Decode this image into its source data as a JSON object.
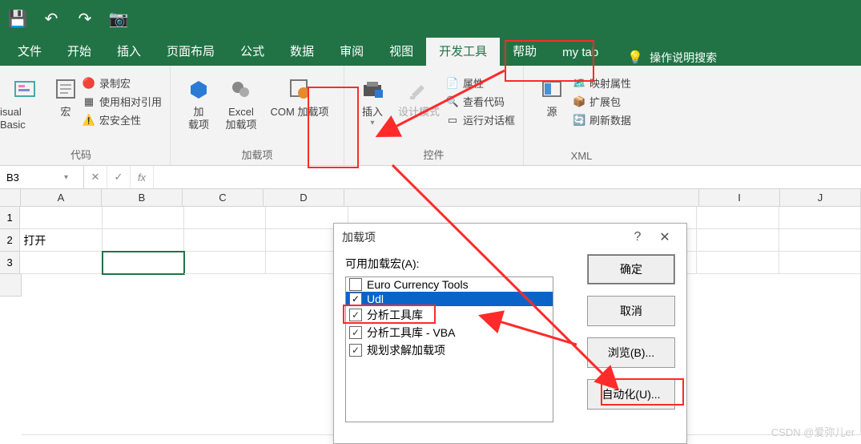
{
  "qat": {
    "save": "💾",
    "undo": "↶",
    "redo": "↷",
    "camera": "📷"
  },
  "tabs": [
    "文件",
    "开始",
    "插入",
    "页面布局",
    "公式",
    "数据",
    "审阅",
    "视图",
    "开发工具",
    "帮助",
    "my tab"
  ],
  "active_tab": "开发工具",
  "tell_me": "操作说明搜索",
  "groups": {
    "code": {
      "label": "代码",
      "vb": "isual Basic",
      "macros": "宏",
      "record": "录制宏",
      "relative": "使用相对引用",
      "security": "宏安全性"
    },
    "addins": {
      "label": "加载项",
      "addins_btn": "加\n载项",
      "excel_addins": "Excel\n加载项",
      "com_addins": "COM 加载项"
    },
    "controls": {
      "label": "控件",
      "insert": "插入",
      "design": "设计模式",
      "properties": "属性",
      "viewcode": "查看代码",
      "dialog": "运行对话框"
    },
    "xml": {
      "label": "XML",
      "source": "源",
      "mapprops": "映射属性",
      "expansion": "扩展包",
      "refresh": "刷新数据"
    }
  },
  "namebox": "B3",
  "cols": [
    "A",
    "B",
    "C",
    "D",
    "",
    "",
    "",
    "",
    "",
    "I",
    "J"
  ],
  "rows": {
    "1": [
      ""
    ],
    "2": [
      "打开"
    ],
    "3": [
      ""
    ]
  },
  "dialog": {
    "title": "加载项",
    "help": "?",
    "available": "可用加载宏(A):",
    "items": [
      {
        "checked": false,
        "label": "Euro Currency Tools",
        "selected": false
      },
      {
        "checked": true,
        "label": "Udl",
        "selected": true
      },
      {
        "checked": true,
        "label": "分析工具库",
        "selected": false
      },
      {
        "checked": true,
        "label": "分析工具库 - VBA",
        "selected": false
      },
      {
        "checked": true,
        "label": "规划求解加载项",
        "selected": false
      }
    ],
    "ok": "确定",
    "cancel": "取消",
    "browse": "浏览(B)...",
    "auto": "自动化(U)..."
  },
  "watermark": "CSDN @爱弥儿er"
}
